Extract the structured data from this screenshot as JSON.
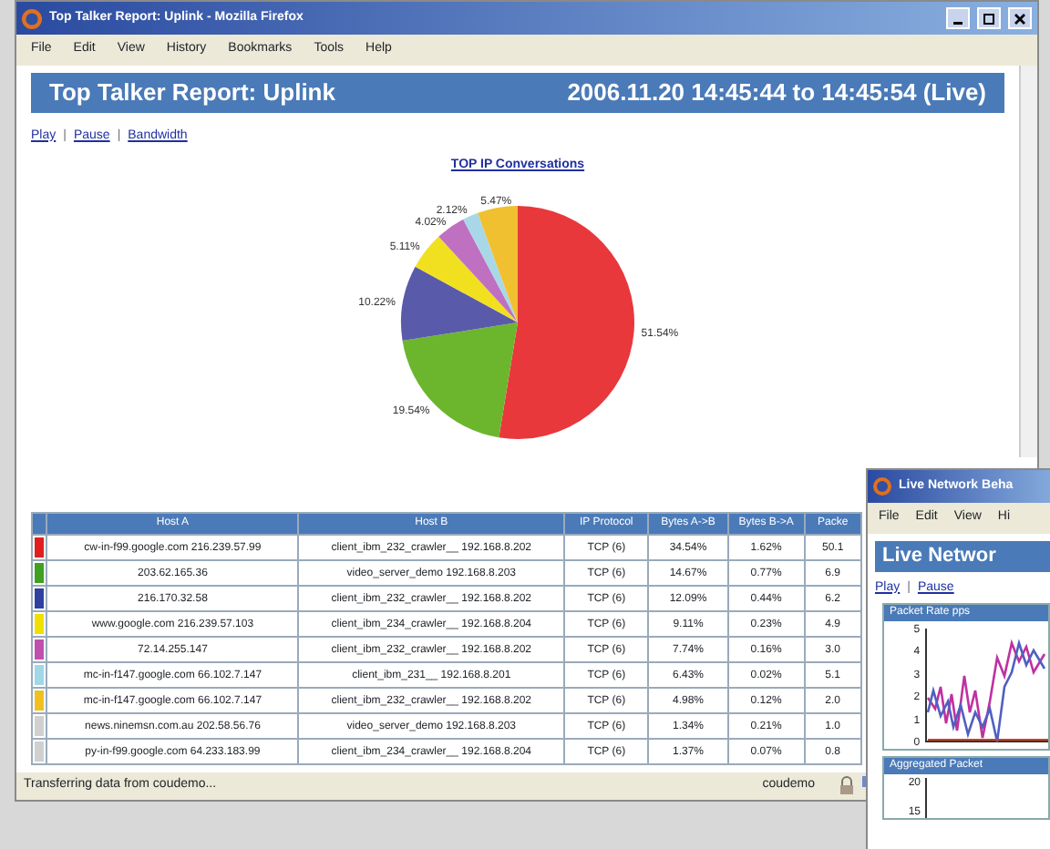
{
  "main_window": {
    "title": "Top Talker Report: Uplink - Mozilla Firefox",
    "menu": [
      "File",
      "Edit",
      "View",
      "History",
      "Bookmarks",
      "Tools",
      "Help"
    ],
    "report_title": "Top Talker Report: Uplink",
    "report_time": "2006.11.20 14:45:44 to 14:45:54 (Live)",
    "links": [
      "Play",
      "Pause",
      "Bandwidth"
    ],
    "link_separators": [
      "|",
      "|"
    ],
    "chart_data": {
      "type": "pie",
      "title": "TOP IP Conversations",
      "values": [
        51.54,
        19.54,
        10.22,
        5.11,
        4.02,
        2.12,
        5.47
      ],
      "colors": [
        "#e8383c",
        "#6cb62e",
        "#5a5aaa",
        "#f0e020",
        "#c070c0",
        "#a8d8e8",
        "#f0c030"
      ],
      "value_labels": [
        "51.54%",
        "19.54%",
        "10.22%",
        "5.11%",
        "4.02%",
        "2.12%",
        "5.47%"
      ]
    },
    "table": {
      "columns": [
        "Host A",
        "Host B",
        "IP Protocol",
        "Bytes A->B",
        "Bytes B->A",
        "Packe"
      ],
      "rows": [
        {
          "color": "#e02020",
          "cells": [
            "cw-in-f99.google.com 216.239.57.99",
            "client_ibm_232_crawler__ 192.168.8.202",
            "TCP (6)",
            "34.54%",
            "1.62%",
            "50.1"
          ]
        },
        {
          "color": "#40a020",
          "cells": [
            "203.62.165.36",
            "video_server_demo 192.168.8.203",
            "TCP (6)",
            "14.67%",
            "0.77%",
            "6.9"
          ]
        },
        {
          "color": "#3040a0",
          "cells": [
            "216.170.32.58",
            "client_ibm_232_crawler__ 192.168.8.202",
            "TCP (6)",
            "12.09%",
            "0.44%",
            "6.2"
          ]
        },
        {
          "color": "#f0e000",
          "cells": [
            "www.google.com 216.239.57.103",
            "client_ibm_234_crawler__ 192.168.8.204",
            "TCP (6)",
            "9.11%",
            "0.23%",
            "4.9"
          ]
        },
        {
          "color": "#c050b0",
          "cells": [
            "72.14.255.147",
            "client_ibm_232_crawler__ 192.168.8.202",
            "TCP (6)",
            "7.74%",
            "0.16%",
            "3.0"
          ]
        },
        {
          "color": "#a0d8e8",
          "cells": [
            "mc-in-f147.google.com 66.102.7.147",
            "client_ibm_231__ 192.168.8.201",
            "TCP (6)",
            "6.43%",
            "0.02%",
            "5.1"
          ]
        },
        {
          "color": "#f0c020",
          "cells": [
            "mc-in-f147.google.com 66.102.7.147",
            "client_ibm_232_crawler__ 192.168.8.202",
            "TCP (6)",
            "4.98%",
            "0.12%",
            "2.0"
          ]
        },
        {
          "color": "#d0d0d0",
          "cells": [
            "news.ninemsn.com.au 202.58.56.76",
            "video_server_demo 192.168.8.203",
            "TCP (6)",
            "1.34%",
            "0.21%",
            "1.0"
          ]
        },
        {
          "color": "#d0d0d0",
          "cells": [
            "py-in-f99.google.com 64.233.183.99",
            "client_ibm_234_crawler__ 192.168.8.204",
            "TCP (6)",
            "1.37%",
            "0.07%",
            "0.8"
          ]
        }
      ]
    },
    "status_bar": {
      "text": "Transferring data from coudemo...",
      "host": "coudemo"
    }
  },
  "second_window": {
    "title": "Live Network Beha",
    "menu": [
      "File",
      "Edit",
      "View",
      "Hi"
    ],
    "report_title": "Live Networ",
    "links": [
      "Play",
      "Pause"
    ],
    "link_separators": [
      "|"
    ],
    "panels": [
      {
        "title": "Packet Rate pps",
        "y_ticks": [
          "5",
          "4",
          "3",
          "2",
          "1",
          "0"
        ]
      },
      {
        "title": "Aggregated Packet",
        "y_ticks": [
          "20",
          "15"
        ]
      }
    ]
  }
}
